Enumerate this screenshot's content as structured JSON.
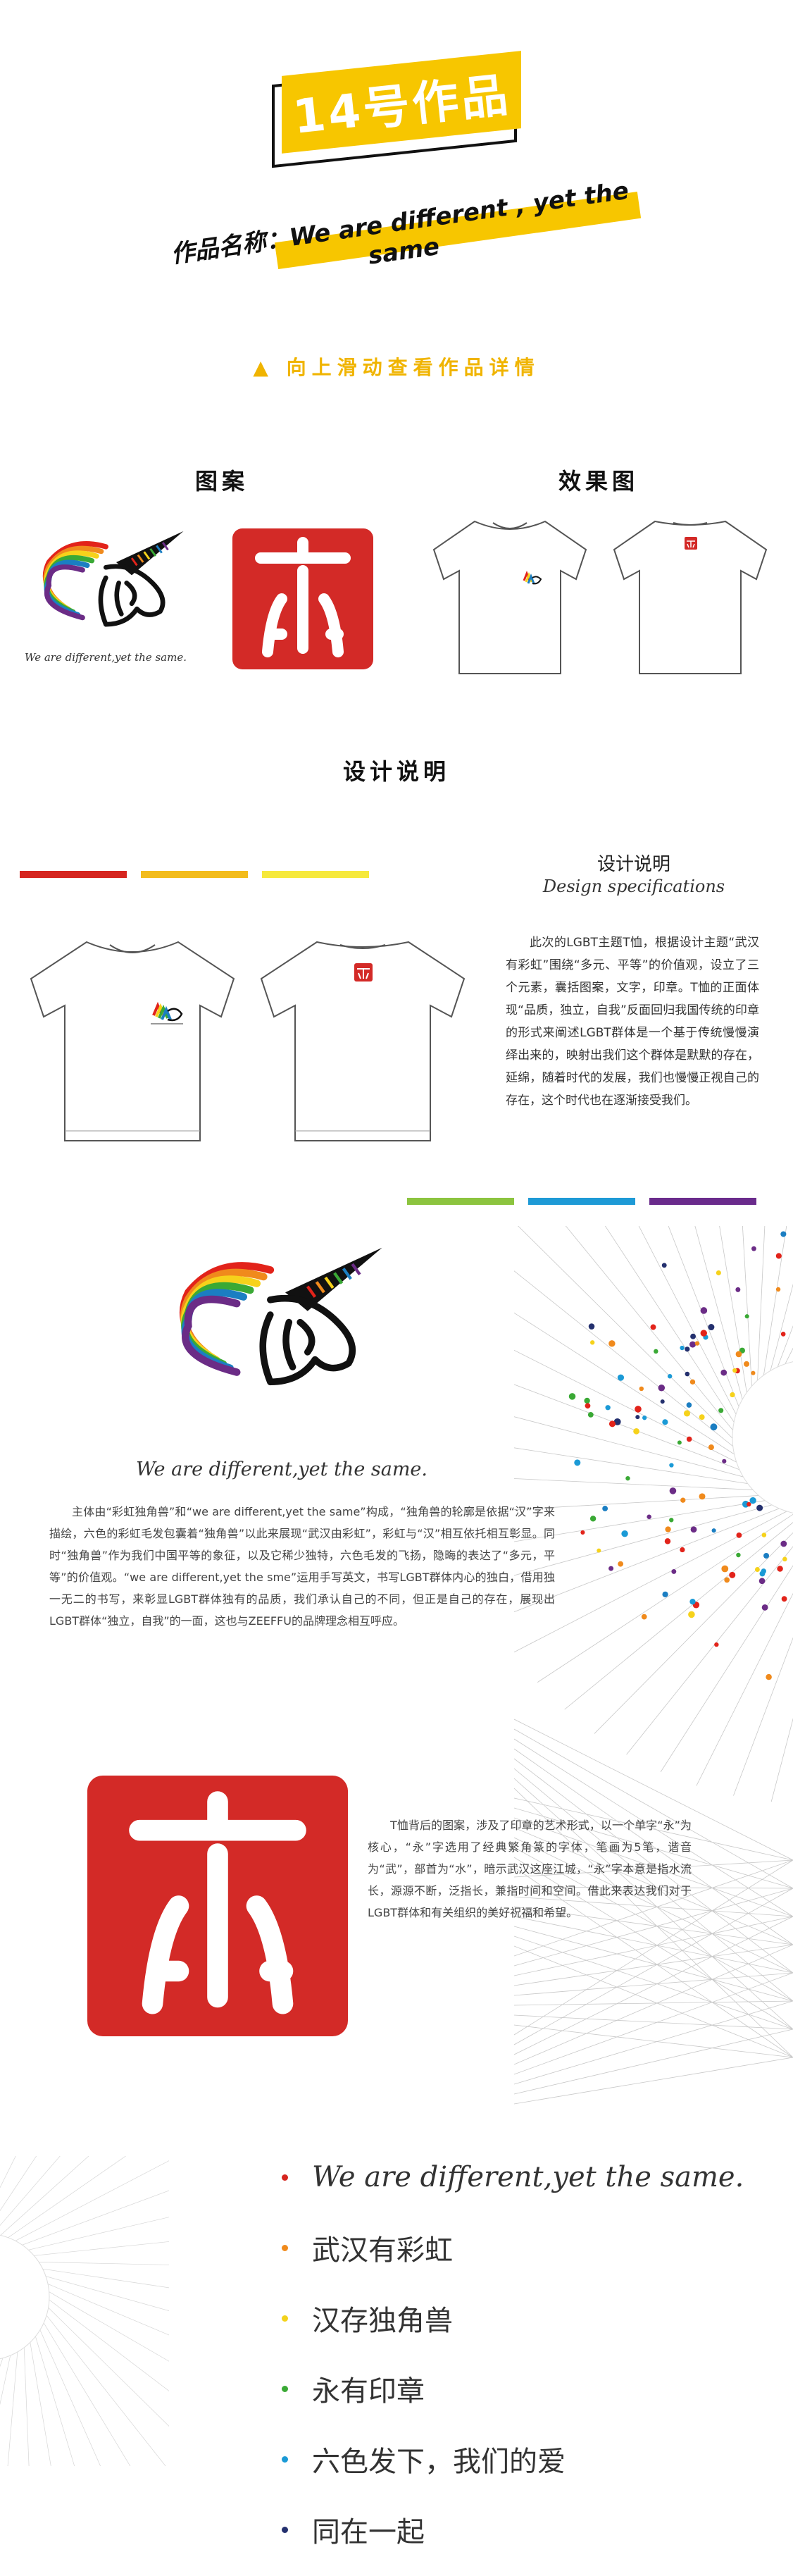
{
  "header": {
    "badge": "14号作品",
    "work_title": "作品名称：We are different , yet the same",
    "swipe_hint": "▲ 向上滑动查看作品详情"
  },
  "sections": {
    "pattern": "图案",
    "effect": "效果图",
    "design_note": "设计说明"
  },
  "unicorn_caption": "We are different,yet the same.",
  "design": {
    "heading": "设计说明",
    "subheading": "Design specifications",
    "paragraph": "此次的LGBT主题T恤，根据设计主题“武汉有彩虹”围绕“多元、平等”的价值观，设立了三个元素，囊括图案，文字，印章。T恤的正面体现“品质，独立，自我”反面回归我国传统的印章的形式来阐述LGBT群体是一个基于传统慢慢演绎出来的，映射出我们这个群体是默默的存在，延绵，随着时代的发展，我们也慢慢正视自己的存在，这个时代也在逐渐接受我们。"
  },
  "top_bars": [
    "#d6251f",
    "#f3bc1c",
    "#f6e93c"
  ],
  "bottom_bars": [
    "#8cc43f",
    "#1e9ad6",
    "#6a2b8c"
  ],
  "rainbow": [
    "#e2231a",
    "#f08a1c",
    "#f6d21b",
    "#3aa935",
    "#1b7ec2",
    "#6b2c86"
  ],
  "unicorn_para": "主体由“彩虹独角兽”和“we are different,yet the same”构成，“独角兽的轮廓是依据“汉”字来描绘，六色的彩虹毛发包囊着“独角兽”以此来展现“武汉由彩虹”，彩虹与“汉”相互依托相互彰显。同时“独角兽”作为我们中国平等的象征，以及它稀少独特，六色毛发的飞扬，隐晦的表达了“多元，平等”的价值观。“we are different,yet the sme”运用手写英文，书写LGBT群体内心的独白，借用独一无二的书写，来彰显LGBT群体独有的品质，我们承认自己的不同，但正是自己的存在，展现出LGBT群体“独立，自我”的一面，这也与ZEEFFU的品牌理念相互呼应。",
  "seal_para": "T恤背后的图案，涉及了印章的艺术形式，以一个单字“永”为核心，“永”字选用了经典繁角篆的字体，笔画为5笔，谐音为“武”，部首为“水”，暗示武汉这座江城，“永”字本意是指水流长，源源不断，泛指长，兼指时间和空间。借此来表达我们对于LGBT群体和有关组织的美好祝福和希望。",
  "slogans": [
    {
      "text": "We are different,yet the same.",
      "color": "#d6251f"
    },
    {
      "text": "武汉有彩虹",
      "color": "#f08a1c"
    },
    {
      "text": "汉存独角兽",
      "color": "#f3d21c"
    },
    {
      "text": "永有印章",
      "color": "#3aa935"
    },
    {
      "text": "六色发下，我们的爱",
      "color": "#1b9ad6"
    },
    {
      "text": "同在一起",
      "color": "#24306e"
    }
  ]
}
